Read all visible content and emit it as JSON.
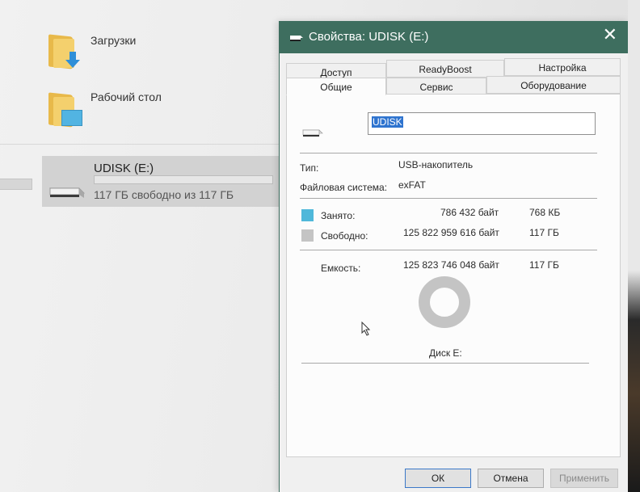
{
  "explorer": {
    "folders": [
      {
        "label": "Загрузки",
        "icon": "downloads-folder-icon"
      },
      {
        "label": "Рабочий стол",
        "icon": "desktop-folder-icon"
      }
    ],
    "drive": {
      "name": "UDISK (E:)",
      "free_text": "117 ГБ свободно из 117 ГБ",
      "used_fraction": 0.0,
      "icon": "usb-drive-icon"
    }
  },
  "dialog": {
    "title": "Свойства: UDISK (E:)",
    "close_icon": "close-icon",
    "tabs_row1": [
      "Доступ",
      "ReadyBoost",
      "Настройка"
    ],
    "tabs_row2": [
      "Общие",
      "Сервис",
      "Оборудование"
    ],
    "active_tab": "Общие",
    "volume_label": "UDISK",
    "type_label": "Тип:",
    "type_value": "USB-накопитель",
    "fs_label": "Файловая система:",
    "fs_value": "exFAT",
    "used": {
      "label": "Занято:",
      "bytes": "786 432 байт",
      "size": "768 КБ",
      "color": "#4fb8da"
    },
    "free": {
      "label": "Свободно:",
      "bytes": "125 822 959 616 байт",
      "size": "117 ГБ",
      "color": "#c4c4c4"
    },
    "capacity": {
      "label": "Емкость:",
      "bytes": "125 823 746 048 байт",
      "size": "117 ГБ"
    },
    "disk_label": "Диск E:",
    "used_fraction": 6.25e-06,
    "buttons": {
      "ok": "ОК",
      "cancel": "Отмена",
      "apply": "Применить"
    }
  },
  "colors": {
    "titlebar": "#3e6e5f",
    "selection": "#2f74cf"
  }
}
